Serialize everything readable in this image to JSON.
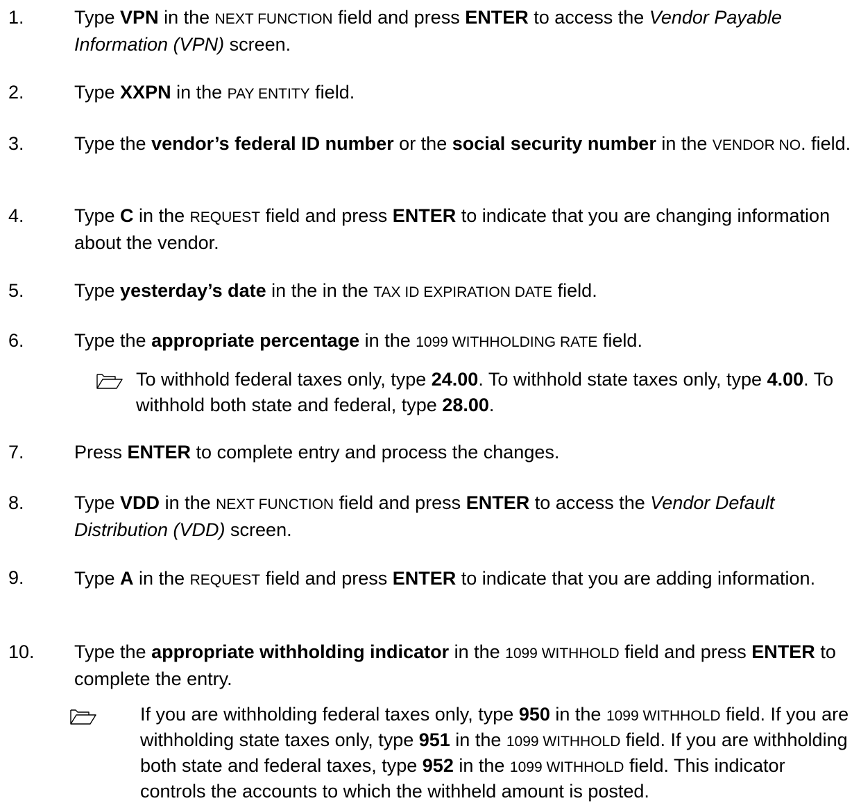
{
  "steps": [
    {
      "num": "1.",
      "p": [
        "Type ",
        "VPN",
        " in the ",
        "NEXT FUNCTION",
        " field and press ",
        "ENTER",
        " to access the ",
        "Vendor Payable Information (VPN)",
        " screen."
      ]
    },
    {
      "num": "2.",
      "p": [
        "Type ",
        "XXPN",
        " in the ",
        "PAY ENTITY",
        " field."
      ]
    },
    {
      "num": "3.",
      "p": [
        "Type the ",
        "vendor’s federal ID number",
        " or the ",
        "social security number",
        " in the ",
        "VENDOR NO",
        ". field."
      ]
    },
    {
      "num": "4.",
      "p": [
        "Type ",
        "C",
        " in the ",
        "REQUEST",
        " field and press ",
        "ENTER",
        " to indicate that you are changing information about the vendor."
      ]
    },
    {
      "num": "5.",
      "p": [
        "Type ",
        "yesterday’s date",
        " in the in the ",
        "TAX ID EXPIRATION DATE",
        " field."
      ]
    },
    {
      "num": "6.",
      "p": [
        "Type the ",
        "appropriate percentage",
        " in the ",
        "1099 WITHHOLDING RATE",
        " field."
      ]
    },
    {
      "num": "7.",
      "p": [
        "Press ",
        "ENTER",
        " to complete entry and process the changes."
      ]
    },
    {
      "num": "8.",
      "p": [
        "Type ",
        "VDD",
        " in the ",
        "NEXT FUNCTION",
        " field and press ",
        "ENTER",
        " to access the ",
        "Vendor Default Distribution (VDD)",
        " screen."
      ]
    },
    {
      "num": "9.",
      "p": [
        "Type ",
        "A",
        " in the ",
        "REQUEST",
        " field and press ",
        "ENTER",
        " to indicate that you are adding information."
      ]
    },
    {
      "num": "10.",
      "p": [
        "Type the ",
        "appropriate withholding indicator",
        " in the ",
        "1099 WITHHOLD",
        " field and press ",
        "ENTER",
        " to complete the entry."
      ]
    }
  ],
  "notes": {
    "step6": [
      "To withhold federal taxes only, type ",
      "24.00",
      ". To withhold state taxes only, type ",
      "4.00",
      ". To withhold both state and federal, type ",
      "28.00",
      "."
    ],
    "step10": [
      "If you are withholding federal taxes only, type ",
      "950",
      " in the ",
      "1099 WITHHOLD",
      " field. If you are withholding state taxes only, type ",
      "951",
      " in the ",
      "1099 WITHHOLD",
      " field. If you are withholding both state and federal taxes, type ",
      "952",
      " in the ",
      "1099 WITHHOLD",
      " field. This indicator controls the accounts to which the withheld amount is posted."
    ]
  },
  "icons": {
    "note": "open-folder-icon"
  }
}
